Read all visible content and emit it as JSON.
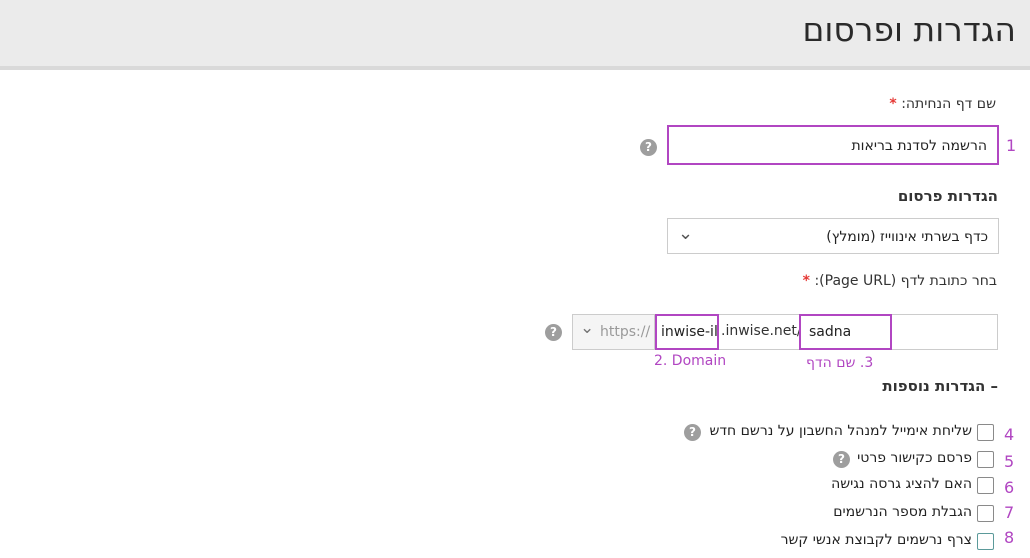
{
  "header": {
    "title": "הגדרות ופרסום"
  },
  "landing_name": {
    "label": "שם דף הנחיתה:",
    "required_mark": "*",
    "value": "הרשמה לסדנת בריאות",
    "step": "1",
    "help": "?"
  },
  "publish_settings": {
    "label": "הגדרות פרסום",
    "selected": "כדף בשרתי אינווייז (מומלץ)",
    "chevron": "⌄"
  },
  "page_url": {
    "label": "בחר כתובת לדף (Page URL):",
    "required_mark": "*",
    "protocol": "https://",
    "subdomain": "inwise-il",
    "domain_suffix": ".inwise.net/",
    "page_name": "sadna",
    "help": "?",
    "annotation_domain": "2. Domain",
    "annotation_page": "3. שם הדף"
  },
  "more_settings": {
    "label": "– הגדרות נוספות"
  },
  "options": [
    {
      "step": "4",
      "label": "שליחת אימייל למנהל החשבון על נרשם חדש",
      "help": "?"
    },
    {
      "step": "5",
      "label": "פרסם כקישור פרטי",
      "help": "?"
    },
    {
      "step": "6",
      "label": "האם להציג גרסה נגישה"
    },
    {
      "step": "7",
      "label": "הגבלת מספר הנרשמים"
    },
    {
      "step": "8",
      "label": "צרף נרשמים לקבוצת אנשי קשר"
    }
  ]
}
